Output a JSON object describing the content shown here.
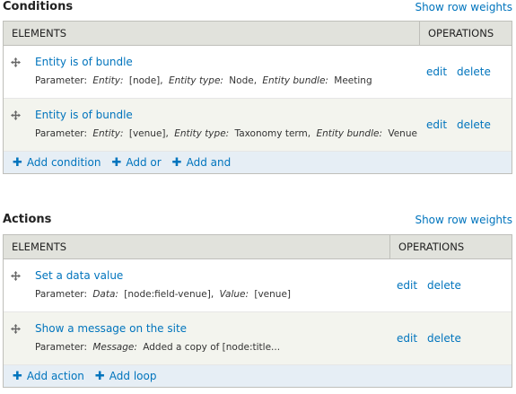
{
  "conditions": {
    "title": "Conditions",
    "show_row_weights": "Show row weights",
    "col_elements": "ELEMENTS",
    "col_operations": "OPERATIONS",
    "rows": [
      {
        "title": "Entity is of bundle",
        "param_prefix": "Parameter:",
        "params": [
          {
            "k": "Entity:",
            "v": "[node],"
          },
          {
            "k": "Entity type:",
            "v": "Node,"
          },
          {
            "k": "Entity bundle:",
            "v": "Meeting"
          }
        ],
        "edit": "edit",
        "delete": "delete"
      },
      {
        "title": "Entity is of bundle",
        "param_prefix": "Parameter:",
        "params": [
          {
            "k": "Entity:",
            "v": "[venue],"
          },
          {
            "k": "Entity type:",
            "v": "Taxonomy term,"
          },
          {
            "k": "Entity bundle:",
            "v": "Venue"
          }
        ],
        "edit": "edit",
        "delete": "delete"
      }
    ],
    "add_links": [
      "Add condition",
      "Add or",
      "Add and"
    ]
  },
  "actions": {
    "title": "Actions",
    "show_row_weights": "Show row weights",
    "col_elements": "ELEMENTS",
    "col_operations": "OPERATIONS",
    "rows": [
      {
        "title": "Set a data value",
        "param_prefix": "Parameter:",
        "params": [
          {
            "k": "Data:",
            "v": "[node:field-venue],"
          },
          {
            "k": "Value:",
            "v": "[venue]"
          }
        ],
        "edit": "edit",
        "delete": "delete"
      },
      {
        "title": "Show a message on the site",
        "param_prefix": "Parameter:",
        "params": [
          {
            "k": "Message:",
            "v": "Added a copy of [node:title..."
          }
        ],
        "edit": "edit",
        "delete": "delete"
      }
    ],
    "add_links": [
      "Add action",
      "Add loop"
    ]
  },
  "colors": {
    "link": "#0074bd",
    "header_bg": "#e1e2dc",
    "add_bar_bg": "#e6eef5"
  }
}
